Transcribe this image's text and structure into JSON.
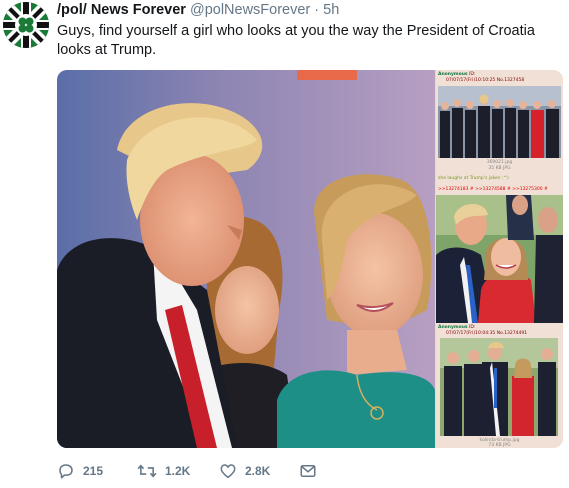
{
  "tweet": {
    "display_name": "/pol/ News Forever",
    "handle": "@polNewsForever",
    "separator": "·",
    "time": "5h",
    "text": "Guys, find yourself a girl who looks at you the way the President of Croatia looks at Trump."
  },
  "side_panel": {
    "post1": {
      "name": "Anonymous",
      "id": "ID: ",
      "meta": "07/07/17(Fri)10:10:25 No.1327458"
    },
    "post1_file": "369021.jpg",
    "post1_size": "35 KB JPG",
    "post1_green": "she laughs at Trump's jokes :^)",
    "post1_links": ">>13274183 # >>13274588 # >>13275300 #",
    "post2": {
      "name": "Anonymous",
      "id": "ID: ",
      "meta": "07/07/17(Fri)10:04:35 No.13274491"
    },
    "post2_file": "kolinda-trump.jpg",
    "post2_size": "73 KB JPG"
  },
  "actions": {
    "reply_count": "215",
    "retweet_count": "1.2K",
    "like_count": "2.8K"
  },
  "colors": {
    "text": "#14171a",
    "secondary": "#657786",
    "chan_bg": "#f0e0d6"
  },
  "icons": [
    "reply-icon",
    "retweet-icon",
    "like-icon",
    "dm-icon",
    "flag-icon"
  ]
}
